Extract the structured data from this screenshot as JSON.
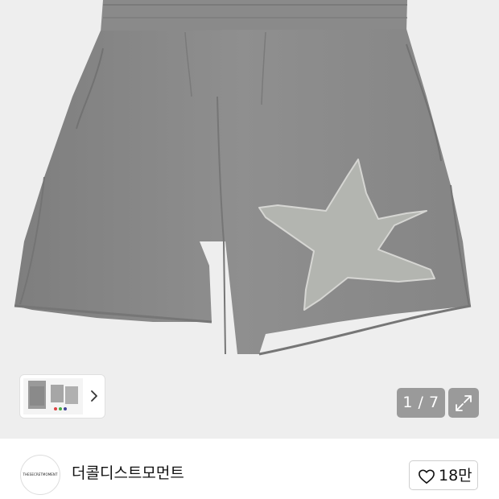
{
  "gallery": {
    "counter": "1 / 7",
    "thumbnail_icon": "chevron-right-icon",
    "expand_icon": "expand-icon"
  },
  "seller": {
    "avatar_text": "THESECRETMOMENT",
    "name": "더콜디스트모먼트",
    "like_icon": "heart-outline-icon",
    "like_count": "18만"
  },
  "colors": {
    "background": "#eeeeee",
    "fabric": "#8c8c8c",
    "patch": "#b3b5b0",
    "badge": "#9a9a9a"
  }
}
